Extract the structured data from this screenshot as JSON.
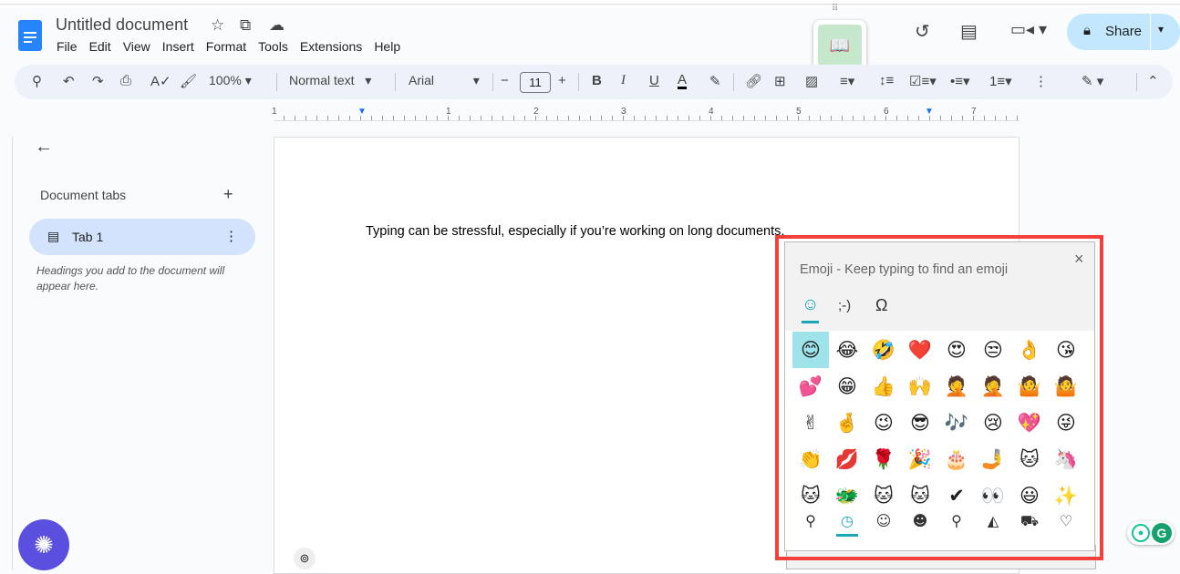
{
  "doc": {
    "title": "Untitled document",
    "menu": [
      "File",
      "Edit",
      "View",
      "Insert",
      "Format",
      "Tools",
      "Extensions",
      "Help"
    ]
  },
  "toolbar": {
    "zoom": "100%",
    "style": "Normal text",
    "font": "Arial",
    "font_size": "11"
  },
  "header": {
    "share": "Share"
  },
  "ruler": [
    "1",
    "1",
    "2",
    "3",
    "4",
    "5",
    "6",
    "7"
  ],
  "sidebar": {
    "section": "Document tabs",
    "tab": "Tab 1",
    "hint": "Headings you add to the document will appear here."
  },
  "body": {
    "text": "Typing can be stressful, especially if you’re working on long documents."
  },
  "emoji_panel": {
    "title": "Emoji - Keep typing to find an emoji",
    "tabs": [
      "☺",
      ";-)",
      "Ω"
    ],
    "emojis": [
      "😊",
      "😂",
      "🤣",
      "❤️",
      "😍",
      "😒",
      "👌",
      "😘",
      "💕",
      "😁",
      "👍",
      "🙌",
      "🤦",
      "🤦",
      "🤷",
      "🤷",
      "✌",
      "🤞",
      "😉",
      "😎",
      "🎶",
      "😢",
      "💖",
      "😜",
      "👏",
      "💋",
      "🌹",
      "🎉",
      "🎂",
      "🤳",
      "🐱",
      "🦄",
      "🐱",
      "🐲",
      "🐱",
      "🐱",
      "✔",
      "👀",
      "😃",
      "✨"
    ],
    "categories": [
      "⚲",
      "◷",
      "☺",
      "☻",
      "⚲",
      "◭",
      "⛟",
      "♡"
    ]
  },
  "colors": {
    "accent": "#0b57d0",
    "share_bg": "#c2e7ff",
    "highlight": "#f4403a",
    "selected_emoji": "#9ee3ea"
  }
}
